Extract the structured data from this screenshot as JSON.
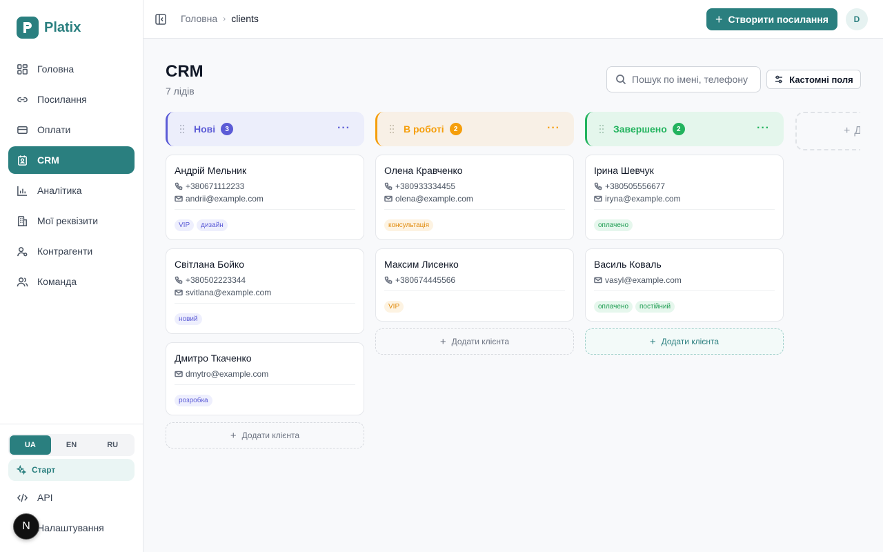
{
  "app": {
    "name": "Platix"
  },
  "sidebar": {
    "items": [
      {
        "label": "Головна",
        "icon": "grid-icon"
      },
      {
        "label": "Посилання",
        "icon": "link-icon"
      },
      {
        "label": "Оплати",
        "icon": "card-icon"
      },
      {
        "label": "CRM",
        "icon": "contact-icon",
        "active": true
      },
      {
        "label": "Аналітика",
        "icon": "chart-icon"
      },
      {
        "label": "Мої реквізити",
        "icon": "building-icon"
      },
      {
        "label": "Контрагенти",
        "icon": "user-gear-icon"
      },
      {
        "label": "Команда",
        "icon": "users-icon"
      }
    ],
    "languages": [
      "UA",
      "EN",
      "RU"
    ],
    "active_language": "UA",
    "start_label": "Старт",
    "api_label": "API",
    "settings_label": "Налаштування",
    "dev_badge": "N"
  },
  "topbar": {
    "breadcrumb_home": "Головна",
    "breadcrumb_current": "clients",
    "create_label": "Створити посилання",
    "avatar_initial": "D"
  },
  "page": {
    "title": "CRM",
    "subtitle": "7 лідів",
    "search_placeholder": "Пошук по імені, телефону",
    "custom_fields_label": "Кастомні поля",
    "add_client_label": "Додати клієнта",
    "add_column_label": "Д"
  },
  "columns": [
    {
      "title": "Нові",
      "count": "3",
      "cards": [
        {
          "name": "Андрій Мельник",
          "phone": "+380671112233",
          "email": "andrii@example.com",
          "tags": [
            "VIP",
            "дизайн"
          ]
        },
        {
          "name": "Світлана Бойко",
          "phone": "+380502223344",
          "email": "svitlana@example.com",
          "tags": [
            "новий"
          ]
        },
        {
          "name": "Дмитро Ткаченко",
          "email": "dmytro@example.com",
          "tags": [
            "розробка"
          ]
        }
      ]
    },
    {
      "title": "В роботі",
      "count": "2",
      "cards": [
        {
          "name": "Олена Кравченко",
          "phone": "+380933334455",
          "email": "olena@example.com",
          "tags": [
            "консультація"
          ]
        },
        {
          "name": "Максим Лисенко",
          "phone": "+380674445566",
          "tags": [
            "VIP"
          ]
        }
      ]
    },
    {
      "title": "Завершено",
      "count": "2",
      "cards": [
        {
          "name": "Ірина Шевчук",
          "phone": "+380505556677",
          "email": "iryna@example.com",
          "tags": [
            "оплачено"
          ]
        },
        {
          "name": "Василь Коваль",
          "email": "vasyl@example.com",
          "tags": [
            "оплачено",
            "постійний"
          ]
        }
      ]
    }
  ],
  "colors": {
    "brand": "#2a7f7f",
    "new": "#5b5bd6",
    "in_progress": "#f59e0b",
    "done": "#22b35e"
  }
}
